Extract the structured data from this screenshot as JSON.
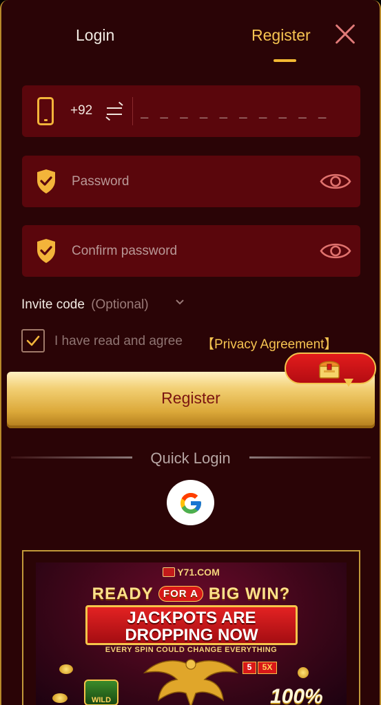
{
  "tabs": {
    "login_label": "Login",
    "register_label": "Register",
    "active": "Register"
  },
  "phone": {
    "country_code": "+92",
    "placeholder": "_ _ _ _ _ _ _ _ _ _"
  },
  "password": {
    "placeholder": "Password"
  },
  "confirm_password": {
    "placeholder": "Confirm password"
  },
  "invite": {
    "label": "Invite code",
    "optional": "(Optional)"
  },
  "agreement": {
    "checked": true,
    "text": "I have read and agree",
    "link": "【Privacy Agreement】"
  },
  "register_button": {
    "label": "Register"
  },
  "quick_login": {
    "label": "Quick Login",
    "providers": [
      "google-icon"
    ]
  },
  "banner": {
    "brand": "Y71.COM",
    "headline_pre": "READY",
    "headline_badge": "FOR A",
    "headline_post": "BIG WIN?",
    "jackpot_line1": "JACKPOTS ARE",
    "jackpot_line2": "DROPPING NOW",
    "tagline": "EVERY SPIN COULD CHANGE EVERYTHING",
    "multiplier_a": "5",
    "multiplier_b": "5X",
    "wild_label": "WILD",
    "percent": "100%"
  },
  "colors": {
    "background": "#2a0406",
    "field": "#5a060c",
    "accent_gold": "#f6c451",
    "icon_gold": "#f3b43a"
  }
}
